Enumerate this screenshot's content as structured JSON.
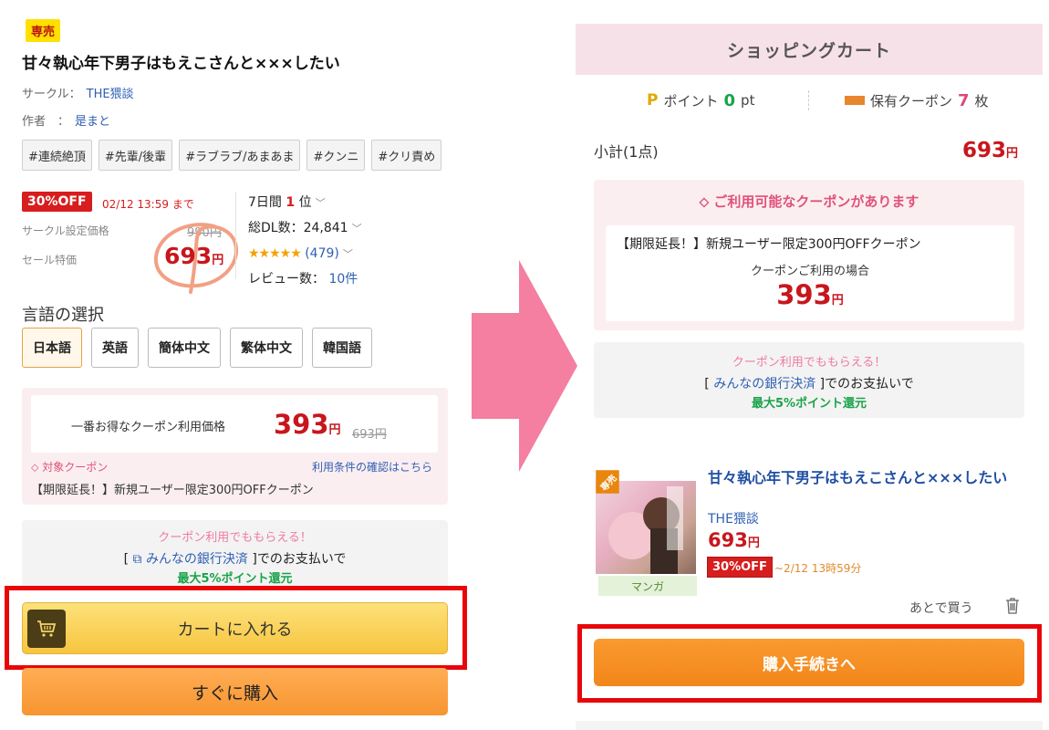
{
  "left": {
    "badge": "専売",
    "title": "甘々執心年下男子はもえこさんと×××したい",
    "circle_label": "サークル：",
    "circle_value": "THE猥談",
    "author_label": "作者　：",
    "author_value": "是まと",
    "tags": [
      "#連続絶頂",
      "#先輩/後輩",
      "#ラブラブ/あまあま",
      "#クンニ",
      "#クリ責め"
    ],
    "discount_badge": "30%OFF",
    "deadline": "02/12 13:59 まで",
    "circle_price_label": "サークル設定価格",
    "circle_price": "990円",
    "sale_label": "セール特価",
    "sale_price": "693",
    "yen": "円",
    "rank_prefix": "7日間",
    "rank_num": "1",
    "rank_suffix": "位",
    "downloads": "総DL数：24,841",
    "stars": "★★★★★",
    "star_count": "(479)",
    "reviews_label": "レビュー数：",
    "reviews_value": "10件",
    "lang_title": "言語の選択",
    "languages": [
      "日本語",
      "英語",
      "簡体中文",
      "繁体中文",
      "韓国語"
    ],
    "best_coupon_label": "一番お得なクーポン利用価格",
    "best_coupon_price": "393",
    "best_coupon_orig": "693円",
    "target_coupon": "対象クーポン",
    "terms_link": "利用条件の確認はこちら",
    "coupon_name": "【期限延長！】新規ユーザー限定300円OFFクーポン",
    "promo_pink": "クーポン利用でももらえる！",
    "promo_pre": "[",
    "promo_link": "みんなの銀行決済",
    "promo_post": "]でのお支払いで",
    "promo_green": "最大5%ポイント還元",
    "cart_button": "カートに入れる",
    "buy_now_button": "すぐに購入"
  },
  "right": {
    "header": "ショッピングカート",
    "points_p": "P",
    "points_label": "ポイント",
    "points_value": "0",
    "points_unit": "pt",
    "coupon_label": "保有クーポン",
    "coupon_value": "7",
    "coupon_unit": "枚",
    "subtotal_label": "小計(1点)",
    "subtotal_value": "693",
    "yen": "円",
    "avail_title": "ご利用可能なクーポンがあります",
    "avail_coupon_name": "【期限延長！】新規ユーザー限定300円OFFクーポン",
    "avail_when": "クーポンご利用の場合",
    "avail_price": "393",
    "promo_pink": "クーポン利用でももらえる！",
    "promo_pre": "[",
    "promo_link": "みんなの銀行決済",
    "promo_post": "]でのお支払いで",
    "promo_green": "最大5%ポイント還元",
    "item_badge": "専売",
    "item_category": "マンガ",
    "item_title": "甘々執心年下男子はもえこさんと×××したい",
    "item_circle": "THE猥談",
    "item_price": "693",
    "item_discount": "30%OFF",
    "item_deadline": "~2/12 13時59分",
    "later": "あとで買う",
    "checkout_button": "購入手続きへ"
  },
  "colors": {
    "sale_red": "#c8161d",
    "coupon_pink": "#e0527a",
    "cart_yellow": "#f7c53f",
    "buy_orange": "#f79530",
    "highlight_red": "#e8060a",
    "arrow_pink": "#f47fa0"
  }
}
